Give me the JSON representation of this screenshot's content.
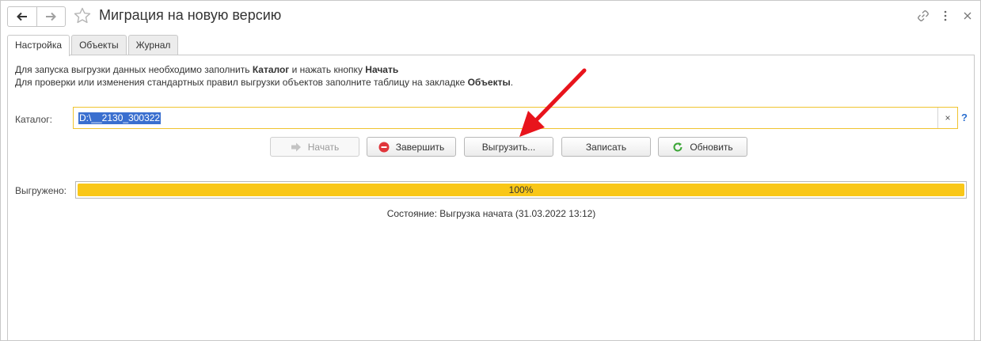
{
  "window": {
    "title": "Миграция на новую версию"
  },
  "tabs": [
    {
      "label": "Настройка",
      "active": true
    },
    {
      "label": "Объекты",
      "active": false
    },
    {
      "label": "Журнал",
      "active": false
    }
  ],
  "info": {
    "line1": {
      "prefix": "Для запуска выгрузки данных необходимо заполнить ",
      "bold1": "Каталог",
      "middle": " и нажать кнопку ",
      "bold2": "Начать"
    },
    "line2": {
      "prefix": "Для проверки или изменения стандартных правил выгрузки объектов заполните таблицу на закладке ",
      "bold": "Объекты",
      "suffix": "."
    }
  },
  "catalog": {
    "label": "Каталог:",
    "value": "D:\\__2130_300322",
    "clear_symbol": "×",
    "help_symbol": "?"
  },
  "buttons": {
    "start": {
      "label": "Начать",
      "enabled": false
    },
    "finish": {
      "label": "Завершить"
    },
    "export": {
      "label": "Выгрузить..."
    },
    "save": {
      "label": "Записать"
    },
    "refresh": {
      "label": "Обновить"
    }
  },
  "progress": {
    "label": "Выгружено:",
    "value_text": "100%",
    "fraction": 1.0
  },
  "status": {
    "text": "Состояние: Выгрузка начата (31.03.2022 13:12)"
  },
  "colors": {
    "accent_yellow": "#f9c718",
    "field_border": "#f0c430",
    "selection_blue": "#3a6fcf",
    "annotation_red": "#e8141c",
    "stop_red": "#e0353b",
    "refresh_green": "#3aa535"
  },
  "icons": {
    "back": "arrow-left-icon",
    "forward": "arrow-right-icon",
    "favorite": "star-icon",
    "link": "link-icon",
    "more": "more-vertical-icon",
    "close": "close-icon",
    "start": "arrow-right-icon",
    "finish": "stop-icon",
    "refresh": "refresh-icon"
  }
}
